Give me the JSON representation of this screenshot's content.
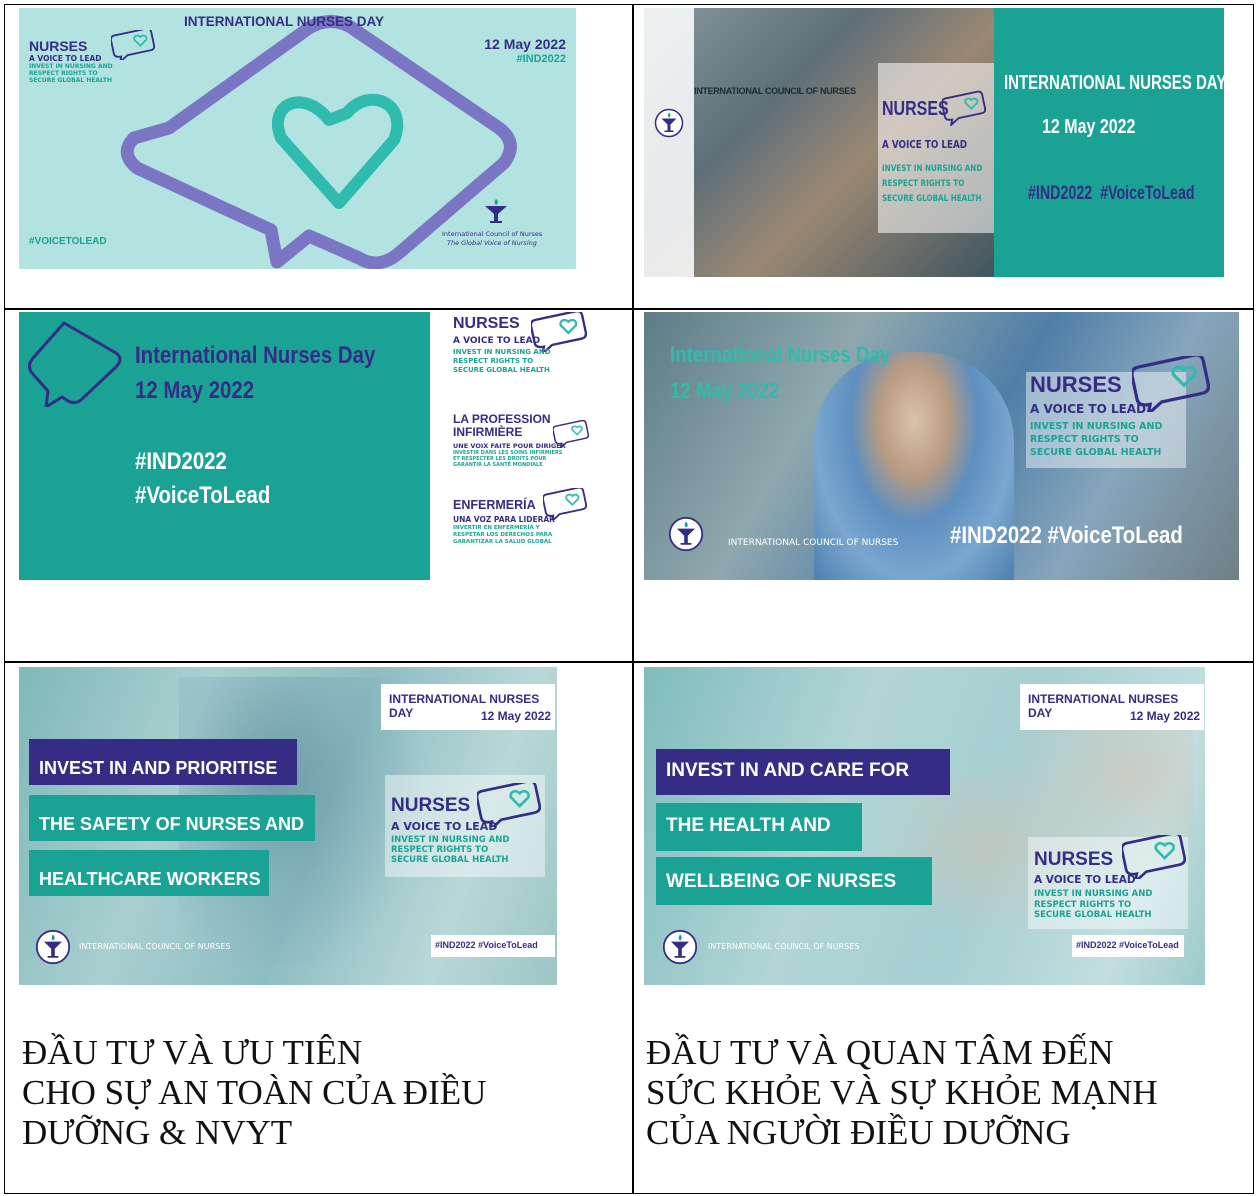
{
  "colors": {
    "teal": "#1aa395",
    "purple": "#352c86",
    "mint": "#b3e3e0",
    "violet": "#7b76c4",
    "heart_teal": "#2fbcae"
  },
  "banner1": {
    "title": "INTERNATIONAL NURSES DAY",
    "nurses": "NURSES",
    "voice": "A VOICE TO LEAD",
    "sub1": "INVEST IN NURSING AND",
    "sub2": "RESPECT RIGHTS TO",
    "sub3": "SECURE GLOBAL HEALTH",
    "date": "12 May 2022",
    "hashtag_ind": "#IND2022",
    "hashtag_voice": "#VOICETOLEAD",
    "icn_name": "International Council of Nurses",
    "icn_tagline": "The Global Voice of Nursing"
  },
  "banner2": {
    "icn": "INTERNATIONAL COUNCIL OF NURSES",
    "nurses": "NURSES",
    "voice": "A VOICE TO LEAD",
    "sub1": "INVEST IN NURSING AND",
    "sub2": "RESPECT RIGHTS TO",
    "sub3": "SECURE GLOBAL HEALTH",
    "title": "INTERNATIONAL NURSES DAY",
    "date": "12 May 2022",
    "hashtags": "#IND2022  #VoiceToLead"
  },
  "banner3": {
    "title": "International Nurses Day",
    "date": "12 May 2022",
    "hashtag_ind": "#IND2022",
    "hashtag_voice": "#VoiceToLead",
    "en_title": "NURSES",
    "en_voice": "A VOICE TO LEAD",
    "en_sub1": "INVEST IN NURSING AND",
    "en_sub2": "RESPECT RIGHTS TO",
    "en_sub3": "SECURE GLOBAL HEALTH",
    "fr_title1": "LA PROFESSION",
    "fr_title2": "INFIRMIÈRE",
    "fr_voice": "UNE VOIX FAITE POUR DIRIGER",
    "fr_sub1": "INVESTIR DANS LES SOINS INFIRMIERS",
    "fr_sub2": "ET RESPECTER LES DROITS POUR",
    "fr_sub3": "GARANTIR LA SANTÉ MONDIALE",
    "es_title": "ENFERMERÍA",
    "es_voice": "UNA VOZ PARA LIDERAR",
    "es_sub1": "INVERTIR EN ENFERMERÍA Y",
    "es_sub2": "RESPETAR LOS DERECHOS PARA",
    "es_sub3": "GARANTIZAR LA SALUD GLOBAL"
  },
  "banner4": {
    "title": "International Nurses Day",
    "date": "12 May 2022",
    "nurses": "NURSES",
    "voice": "A VOICE TO LEAD",
    "sub1": "INVEST IN NURSING AND",
    "sub2": "RESPECT RIGHTS TO",
    "sub3": "SECURE GLOBAL HEALTH",
    "icn": "INTERNATIONAL COUNCIL OF NURSES",
    "hashtags": "#IND2022 #VoiceToLead"
  },
  "banner5": {
    "title": "INTERNATIONAL NURSES DAY",
    "date": "12 May 2022",
    "line1": "INVEST IN AND PRIORITISE",
    "line2": "THE SAFETY OF NURSES AND",
    "line3": "HEALTHCARE WORKERS",
    "nurses": "NURSES",
    "voice": "A VOICE TO LEAD",
    "sub1": "INVEST IN NURSING AND",
    "sub2": "RESPECT RIGHTS TO",
    "sub3": "SECURE GLOBAL HEALTH",
    "icn": "INTERNATIONAL COUNCIL OF NURSES",
    "hashtags": "#IND2022 #VoiceToLead"
  },
  "banner6": {
    "title": "INTERNATIONAL NURSES DAY",
    "date": "12 May 2022",
    "line1": "INVEST IN AND CARE FOR",
    "line2": "THE HEALTH AND",
    "line3": "WELLBEING OF NURSES",
    "nurses": "NURSES",
    "voice": "A VOICE TO LEAD",
    "sub1": "INVEST IN NURSING AND",
    "sub2": "RESPECT RIGHTS TO",
    "sub3": "SECURE GLOBAL HEALTH",
    "icn": "INTERNATIONAL COUNCIL OF NURSES",
    "hashtags": "#IND2022 #VoiceToLead"
  },
  "caption_left": [
    "ĐẦU TƯ VÀ ƯU TIÊN",
    "CHO SỰ AN TOÀN CỦA ĐIỀU",
    "DƯỠNG & NVYT"
  ],
  "caption_right": [
    "ĐẦU TƯ VÀ QUAN TÂM ĐẾN",
    "SỨC KHỎE VÀ SỰ KHỎE MẠNH",
    "CỦA NGƯỜI ĐIỀU DƯỠNG"
  ]
}
